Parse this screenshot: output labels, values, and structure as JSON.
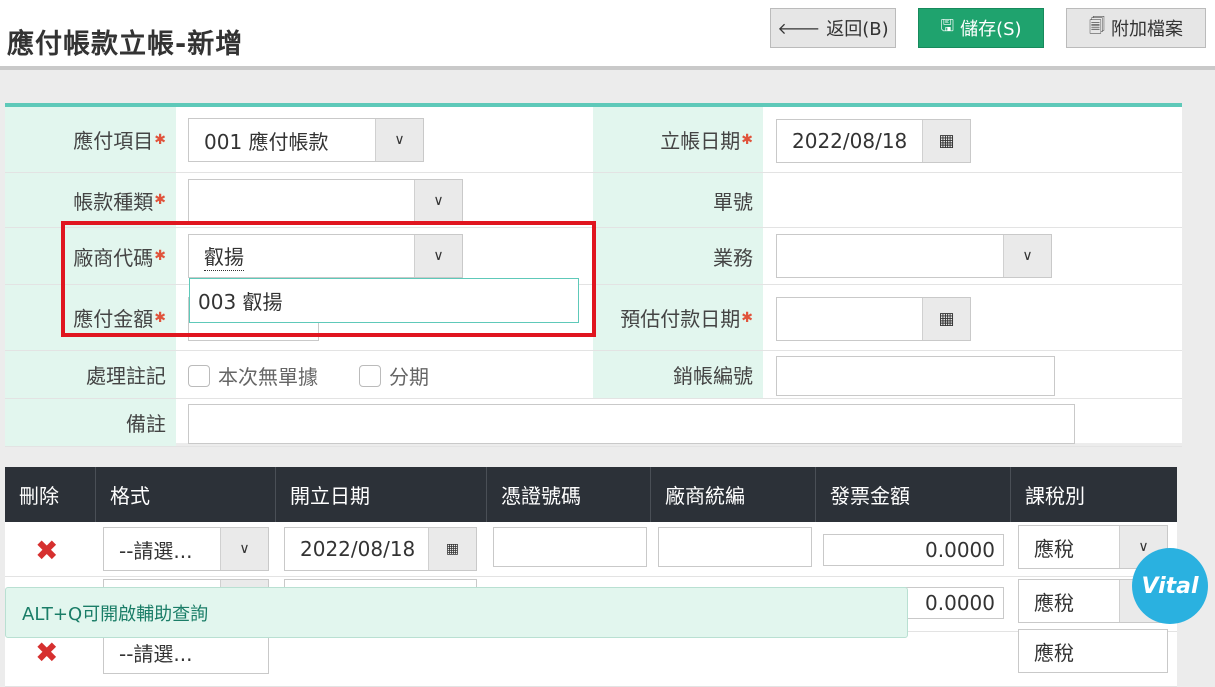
{
  "header": {
    "title": "應付帳款立帳-新增",
    "back_label": "返回(B)",
    "save_label": "儲存(S)",
    "attach_label": "附加檔案"
  },
  "form": {
    "item_label": "應付項目",
    "item_value": "001 應付帳款",
    "date_label": "立帳日期",
    "date_value": "2022/08/18",
    "type_label": "帳款種類",
    "type_value": "",
    "number_label": "單號",
    "vendor_label": "廠商代碼",
    "vendor_value": "叡揚",
    "business_label": "業務",
    "business_value": "",
    "amount_label": "應付金額",
    "pay_date_label": "預估付款日期",
    "pay_date_value": "",
    "process_label": "處理註記",
    "no_doc_label": "本次無單據",
    "installment_label": "分期",
    "writeoff_label": "銷帳編號",
    "remark_label": "備註"
  },
  "vendor_dropdown": {
    "option": "003 叡揚"
  },
  "grid": {
    "headers": [
      "刪除",
      "格式",
      "開立日期",
      "憑證號碼",
      "廠商統編",
      "發票金額",
      "課稅別"
    ],
    "rows": [
      {
        "format": "--請選...",
        "date": "2022/08/18",
        "amount": "0.0000",
        "tax": "應稅"
      },
      {
        "format": "",
        "date": "",
        "amount": "0.0000",
        "tax": "應稅"
      },
      {
        "format": "--請選...",
        "date": "",
        "amount": "",
        "tax": "應稅"
      }
    ]
  },
  "toast": {
    "text": "ALT+Q可開啟輔助查詢"
  },
  "badge": {
    "text": "Vital"
  }
}
